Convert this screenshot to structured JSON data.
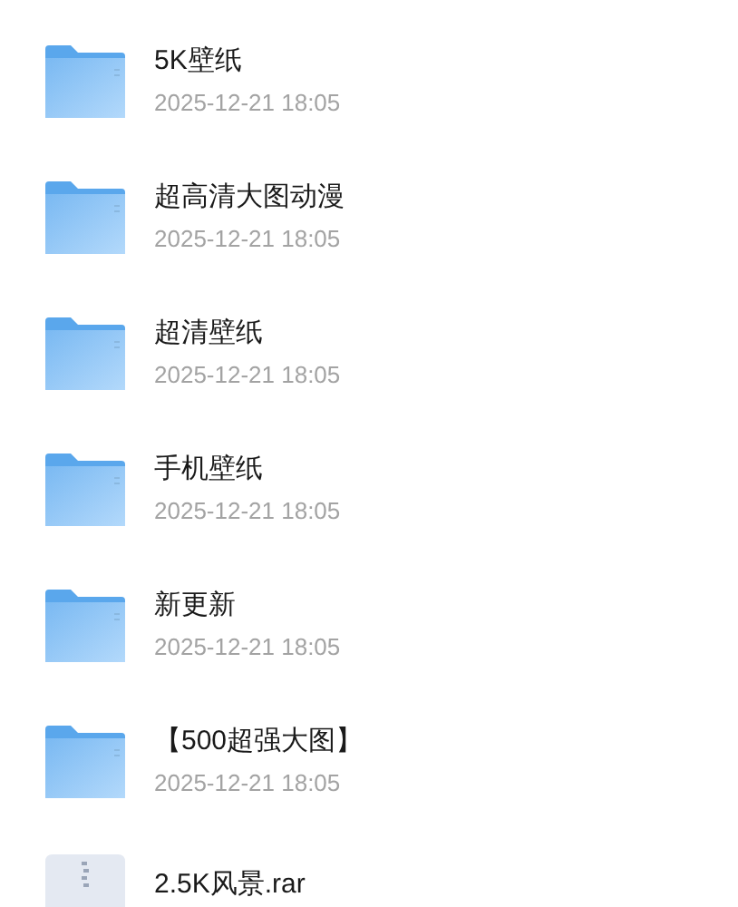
{
  "files": [
    {
      "kind": "folder",
      "name": "5K壁纸",
      "date": "2025-12-21 18:05"
    },
    {
      "kind": "folder",
      "name": "超高清大图动漫",
      "date": "2025-12-21 18:05"
    },
    {
      "kind": "folder",
      "name": "超清壁纸",
      "date": "2025-12-21 18:05"
    },
    {
      "kind": "folder",
      "name": "手机壁纸",
      "date": "2025-12-21 18:05"
    },
    {
      "kind": "folder",
      "name": "新更新",
      "date": "2025-12-21 18:05"
    },
    {
      "kind": "folder",
      "name": "【500超强大图】",
      "date": "2025-12-21 18:05"
    },
    {
      "kind": "archive",
      "name": "2.5K风景.rar"
    }
  ]
}
